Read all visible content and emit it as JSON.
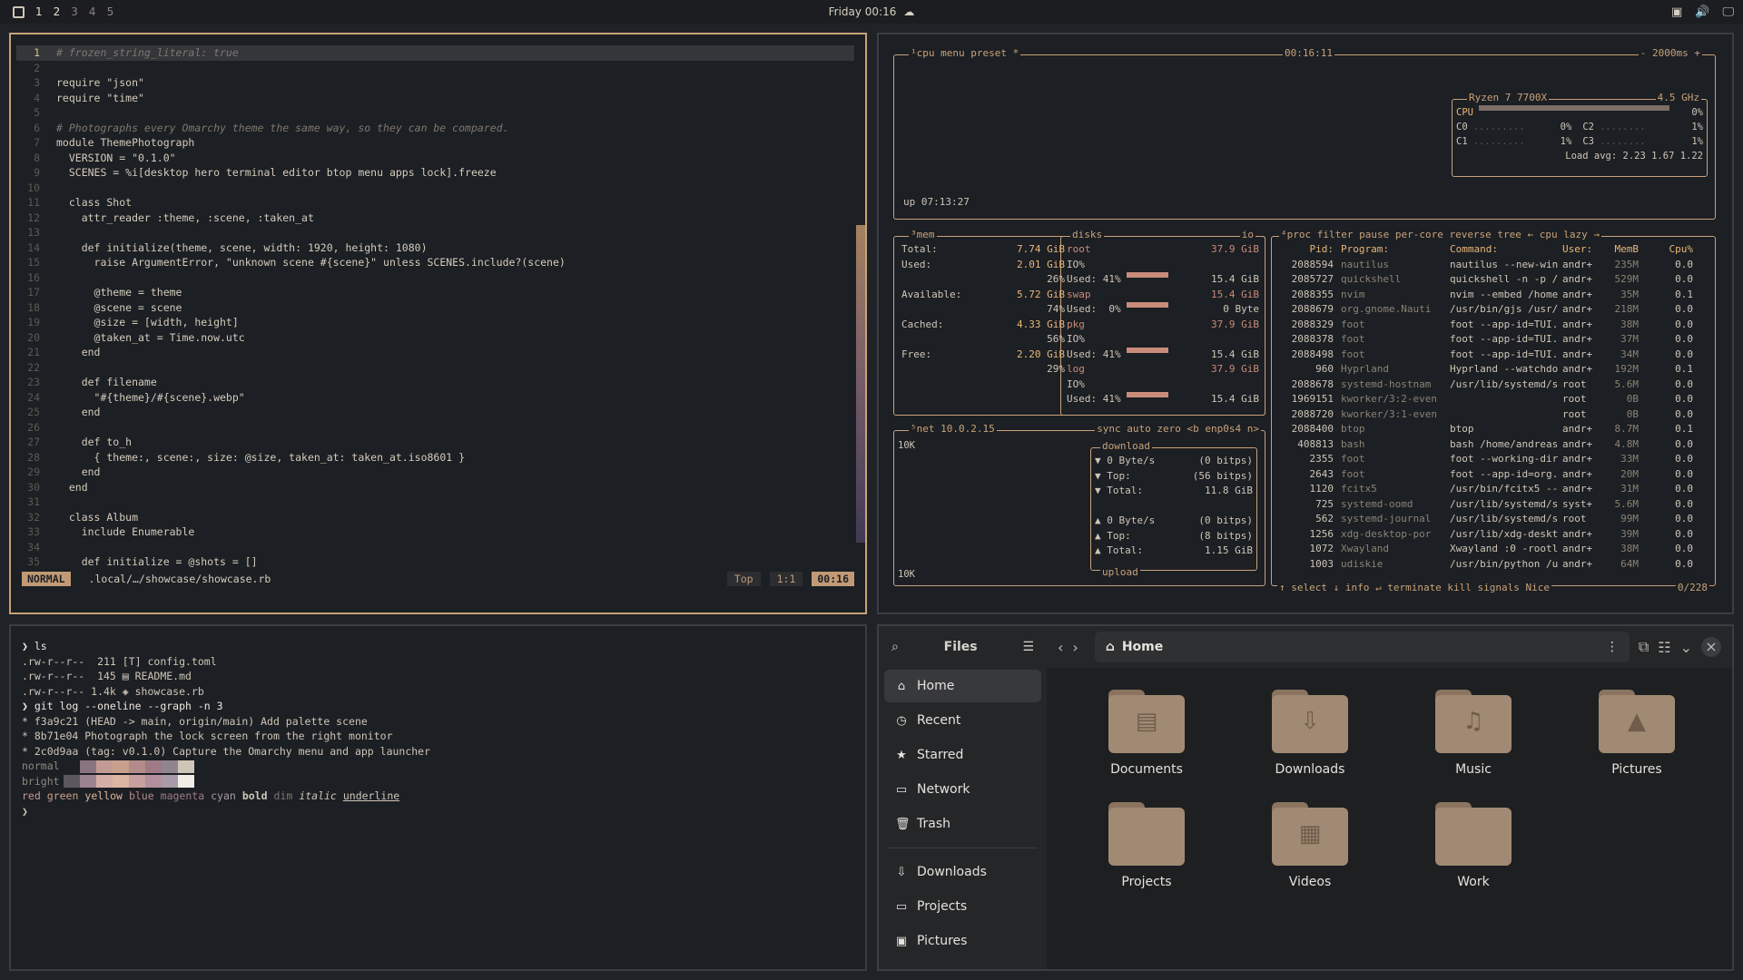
{
  "topbar": {
    "workspaces": [
      "1",
      "2",
      "3",
      "4",
      "5"
    ],
    "clock": "Friday 00:16"
  },
  "editor": {
    "lines": [
      [
        "1",
        "# frozen_string_literal: true"
      ],
      [
        "2",
        ""
      ],
      [
        "3",
        "require \"json\""
      ],
      [
        "4",
        "require \"time\""
      ],
      [
        "5",
        ""
      ],
      [
        "6",
        "# Photographs every Omarchy theme the same way, so they can be compared."
      ],
      [
        "7",
        "module ThemePhotograph"
      ],
      [
        "8",
        "  VERSION = \"0.1.0\""
      ],
      [
        "9",
        "  SCENES = %i[desktop hero terminal editor btop menu apps lock].freeze"
      ],
      [
        "10",
        ""
      ],
      [
        "11",
        "  class Shot"
      ],
      [
        "12",
        "    attr_reader :theme, :scene, :taken_at"
      ],
      [
        "13",
        ""
      ],
      [
        "14",
        "    def initialize(theme, scene, width: 1920, height: 1080)"
      ],
      [
        "15",
        "      raise ArgumentError, \"unknown scene #{scene}\" unless SCENES.include?(scene)"
      ],
      [
        "16",
        ""
      ],
      [
        "17",
        "      @theme = theme"
      ],
      [
        "18",
        "      @scene = scene"
      ],
      [
        "19",
        "      @size = [width, height]"
      ],
      [
        "20",
        "      @taken_at = Time.now.utc"
      ],
      [
        "21",
        "    end"
      ],
      [
        "22",
        ""
      ],
      [
        "23",
        "    def filename"
      ],
      [
        "24",
        "      \"#{theme}/#{scene}.webp\""
      ],
      [
        "25",
        "    end"
      ],
      [
        "26",
        ""
      ],
      [
        "27",
        "    def to_h"
      ],
      [
        "28",
        "      { theme:, scene:, size: @size, taken_at: taken_at.iso8601 }"
      ],
      [
        "29",
        "    end"
      ],
      [
        "30",
        "  end"
      ],
      [
        "31",
        ""
      ],
      [
        "32",
        "  class Album"
      ],
      [
        "33",
        "    include Enumerable"
      ],
      [
        "34",
        ""
      ],
      [
        "35",
        "    def initialize = @shots = []"
      ]
    ],
    "status": {
      "mode": "NORMAL",
      "path": ".local/…/showcase/showcase.rb",
      "pos": "Top",
      "cursor": "1:1",
      "time": "00:16"
    }
  },
  "btop": {
    "cpu_title": "¹cpu",
    "menu": "menu",
    "preset": "preset *",
    "uptime_clock": "00:16:11",
    "ms": "- 2000ms +",
    "up": "up 07:13:27",
    "cpu_model": "Ryzen 7 7700X",
    "freq": "4.5 GHz",
    "cpu_rows": [
      [
        "CPU",
        "0%"
      ],
      [
        "C0",
        "0%",
        "C2",
        "1%"
      ],
      [
        "C1",
        "1%",
        "C3",
        "1%"
      ]
    ],
    "load": "Load avg: 2.23 1.67 1.22",
    "mem": {
      "title": "³mem",
      "rows": [
        [
          "Total:",
          "7.74 GiB"
        ],
        [
          "Used:",
          "2.01 GiB"
        ],
        [
          "",
          "26%"
        ],
        [
          "Available:",
          "5.72 GiB"
        ],
        [
          "",
          "74%"
        ],
        [
          "Cached:",
          "4.33 GiB"
        ],
        [
          "",
          "56%"
        ],
        [
          "Free:",
          "2.20 GiB"
        ],
        [
          "",
          "29%"
        ]
      ]
    },
    "disks": {
      "title": "disks",
      "io": "io",
      "rows": [
        [
          "root",
          "37.9 GiB"
        ],
        [
          "IO%",
          ""
        ],
        [
          "Used: 41%",
          "15.4 GiB"
        ],
        [
          "swap",
          "15.4 GiB"
        ],
        [
          "Used:  0%",
          "0 Byte"
        ],
        [
          "pkg",
          "37.9 GiB"
        ],
        [
          "IO%",
          ""
        ],
        [
          "Used: 41%",
          "15.4 GiB"
        ],
        [
          "log",
          "37.9 GiB"
        ],
        [
          "IO%",
          ""
        ],
        [
          "Used: 41%",
          "15.4 GiB"
        ]
      ]
    },
    "net": {
      "title": "⁵net",
      "ip": "10.0.2.15",
      "opts": "sync auto zero <b enp0s4 n>",
      "scale_top": "10K",
      "scale_bot": "10K",
      "download": "download",
      "upload": "upload",
      "rows": [
        [
          "▼ 0 Byte/s",
          "(0 bitps)"
        ],
        [
          "▼ Top:",
          "(56 bitps)"
        ],
        [
          "▼ Total:",
          "11.8 GiB"
        ],
        [
          "",
          ""
        ],
        [
          "▲ 0 Byte/s",
          "(0 bitps)"
        ],
        [
          "▲ Top:",
          "(8 bitps)"
        ],
        [
          "▲ Total:",
          "1.15 GiB"
        ]
      ]
    },
    "proc": {
      "title": "⁴proc",
      "opts": "filter   pause per-core reverse tree ← cpu lazy →",
      "headers": [
        "Pid:",
        "Program:",
        "Command:",
        "User:",
        "MemB",
        "Cpu%"
      ],
      "rows": [
        [
          "2088594",
          "nautilus",
          "nautilus --new-win",
          "andr+",
          "235M",
          "0.0"
        ],
        [
          "2085727",
          "quickshell",
          "quickshell -n -p /",
          "andr+",
          "529M",
          "0.0"
        ],
        [
          "2088355",
          "nvim",
          "nvim --embed /home",
          "andr+",
          "35M",
          "0.1"
        ],
        [
          "2088679",
          "org.gnome.Nauti",
          "/usr/bin/gjs /usr/",
          "andr+",
          "218M",
          "0.0"
        ],
        [
          "2088329",
          "foot",
          "foot --app-id=TUI.",
          "andr+",
          "38M",
          "0.0"
        ],
        [
          "2088378",
          "foot",
          "foot --app-id=TUI.",
          "andr+",
          "37M",
          "0.0"
        ],
        [
          "2088498",
          "foot",
          "foot --app-id=TUI.",
          "andr+",
          "34M",
          "0.0"
        ],
        [
          "960",
          "Hyprland",
          "Hyprland --watchdo",
          "andr+",
          "192M",
          "0.1"
        ],
        [
          "2088678",
          "systemd-hostnam",
          "/usr/lib/systemd/s",
          "root",
          "5.6M",
          "0.0"
        ],
        [
          "1969151",
          "kworker/3:2-even",
          "",
          "root",
          "0B",
          "0.0"
        ],
        [
          "2088720",
          "kworker/3:1-even",
          "",
          "root",
          "0B",
          "0.0"
        ],
        [
          "2088400",
          "btop",
          "btop",
          "andr+",
          "8.7M",
          "0.1"
        ],
        [
          "408813",
          "bash",
          "bash /home/andreas",
          "andr+",
          "4.8M",
          "0.0"
        ],
        [
          "2355",
          "foot",
          "foot --working-dir",
          "andr+",
          "33M",
          "0.0"
        ],
        [
          "2643",
          "foot",
          "foot --app-id=org.",
          "andr+",
          "20M",
          "0.0"
        ],
        [
          "1120",
          "fcitx5",
          "/usr/bin/fcitx5 --",
          "andr+",
          "31M",
          "0.0"
        ],
        [
          "725",
          "systemd-oomd",
          "/usr/lib/systemd/s",
          "syst+",
          "5.6M",
          "0.0"
        ],
        [
          "562",
          "systemd-journal",
          "/usr/lib/systemd/s",
          "root",
          "99M",
          "0.0"
        ],
        [
          "1256",
          "xdg-desktop-por",
          "/usr/lib/xdg-deskt",
          "andr+",
          "39M",
          "0.0"
        ],
        [
          "1072",
          "Xwayland",
          "Xwayland :0 -rootl",
          "andr+",
          "38M",
          "0.0"
        ],
        [
          "1003",
          "udiskie",
          "/usr/bin/python /u",
          "andr+",
          "64M",
          "0.0"
        ]
      ],
      "footer": "↑ select ↓  info ↵  terminate  kill  signals  Nice",
      "count": "0/228"
    }
  },
  "term": {
    "lines": [
      "❯ ls",
      ".rw-r--r--  211 [T] config.toml",
      ".rw-r--r--  145 ▤ README.md",
      ".rw-r--r-- 1.4k ◈ showcase.rb",
      "❯ git log --oneline --graph -n 3",
      "* f3a9c21 (HEAD -> main, origin/main) Add palette scene",
      "* 8b71e04 Photograph the lock screen from the right monitor",
      "* 2c0d9aa (tag: v0.1.0) Capture the Omarchy menu and app launcher"
    ],
    "normal": "normal",
    "bright": "bright",
    "normal_colors": [
      "#1c1f23",
      "#8a7480",
      "#c49a94",
      "#c9a08c",
      "#b48a8a",
      "#9e7b86",
      "#8f8591",
      "#cfc6b8"
    ],
    "bright_colors": [
      "#5b575e",
      "#9c8390",
      "#d4aea6",
      "#dcb6a0",
      "#c6a09e",
      "#b28f9c",
      "#a89aa8",
      "#f0ece6"
    ],
    "words": [
      "red",
      "green",
      "yellow",
      "blue",
      "magenta",
      "cyan",
      "bold",
      "dim",
      "italic",
      "underline"
    ],
    "prompt": "❯"
  },
  "files": {
    "title": "Files",
    "sidebar": [
      [
        "Home",
        "⌂"
      ],
      [
        "Recent",
        "◷"
      ],
      [
        "Starred",
        "★"
      ],
      [
        "Network",
        "▭"
      ],
      [
        "Trash",
        "🗑"
      ]
    ],
    "bookmarks": [
      [
        "Downloads",
        "⇩"
      ],
      [
        "Projects",
        "▭"
      ],
      [
        "Pictures",
        "▣"
      ]
    ],
    "path": "Home",
    "items": [
      [
        "Documents",
        "▤"
      ],
      [
        "Downloads",
        "⇩"
      ],
      [
        "Music",
        "♫"
      ],
      [
        "Pictures",
        "▲"
      ],
      [
        "Projects",
        ""
      ],
      [
        "Videos",
        "▦"
      ],
      [
        "Work",
        ""
      ]
    ]
  }
}
